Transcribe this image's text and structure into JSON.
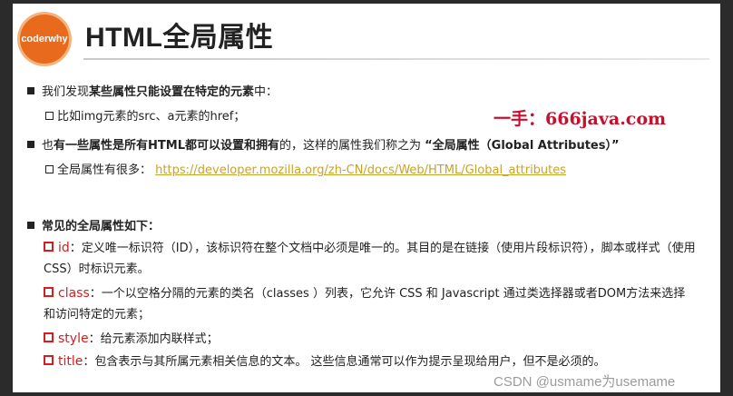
{
  "logo": {
    "text": "coderwhy"
  },
  "title": "HTML全局属性",
  "section1": {
    "lead": "我们发现",
    "bold": "某些属性只能设置在特定的元素",
    "tail": "中：",
    "sub": "比如img元素的src、a元素的href；"
  },
  "section2": {
    "lead": "也",
    "bold": "有一些属性是所有HTML都可以设置和拥有",
    "tail": "的，这样的属性我们称之为",
    "quote": "“全局属性（Global Attributes）”",
    "sub_lead": "全局属性有很多：",
    "sub_link": "https://developer.mozilla.org/zh-CN/docs/Web/HTML/Global_attributes"
  },
  "section3": {
    "heading": "常见的全局属性如下：",
    "items": [
      {
        "name": "id",
        "desc": "：定义唯一标识符（ID），该标识符在整个文档中必须是唯一的。其目的是在链接（使用片段标识符），脚本或样式（使用 CSS）时标识元素。"
      },
      {
        "name": "class",
        "desc": "：一个以空格分隔的元素的类名（classes ）列表，它允许 CSS 和 Javascript 通过类选择器或者DOM方法来选择和访问特定的元素；"
      },
      {
        "name": "style",
        "desc": "：给元素添加内联样式；"
      },
      {
        "name": "title",
        "desc": "：包含表示与其所属元素相关信息的文本。 这些信息通常可以作为提示呈现给用户，但不是必须的。"
      }
    ]
  },
  "watermark": "一手：666java.com",
  "csdn": "CSDN @usmame为usemame",
  "colors": {
    "accent": "#e86a1c",
    "attr": "#d02020",
    "link": "#c9a227"
  }
}
